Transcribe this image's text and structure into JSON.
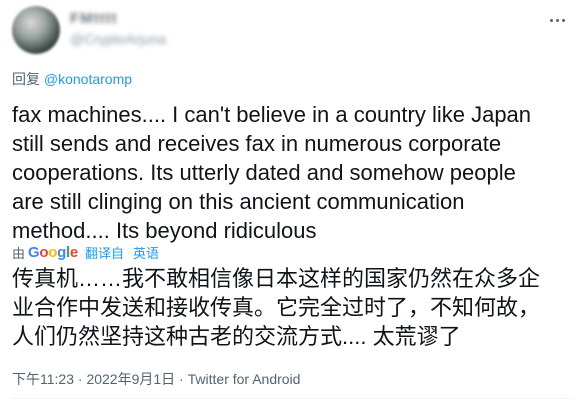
{
  "author": {
    "display_name": "FMtttt",
    "handle": "@CryptoArjuna"
  },
  "reply": {
    "prefix": "回复 ",
    "mention": "@konotaromp"
  },
  "tweet": {
    "text": "fax machines.... I can't believe in a country like Japan\nstill sends and receives fax in numerous corporate\ncooperations. Its utterly dated and somehow people\nare still clinging on this ancient communication\nmethod.... Its beyond ridiculous",
    "translation": {
      "by_prefix": "由",
      "provider_letters": [
        "G",
        "o",
        "o",
        "g",
        "l",
        "e"
      ],
      "translated_from_label": "翻译自",
      "language": "英语",
      "text": "传真机……我不敢相信像日本这样的国家仍然在众多企\n业合作中发送和接收传真。它完全过时了，不知何故，\n人们仍然坚持这种古老的交流方式.... 太荒谬了"
    }
  },
  "meta": {
    "time": "下午11:23",
    "date": "2022年9月1日",
    "separator": " · ",
    "source": "Twitter for Android"
  },
  "icons": {
    "more": "more-horizontal-icon",
    "avatar": "avatar-image"
  }
}
